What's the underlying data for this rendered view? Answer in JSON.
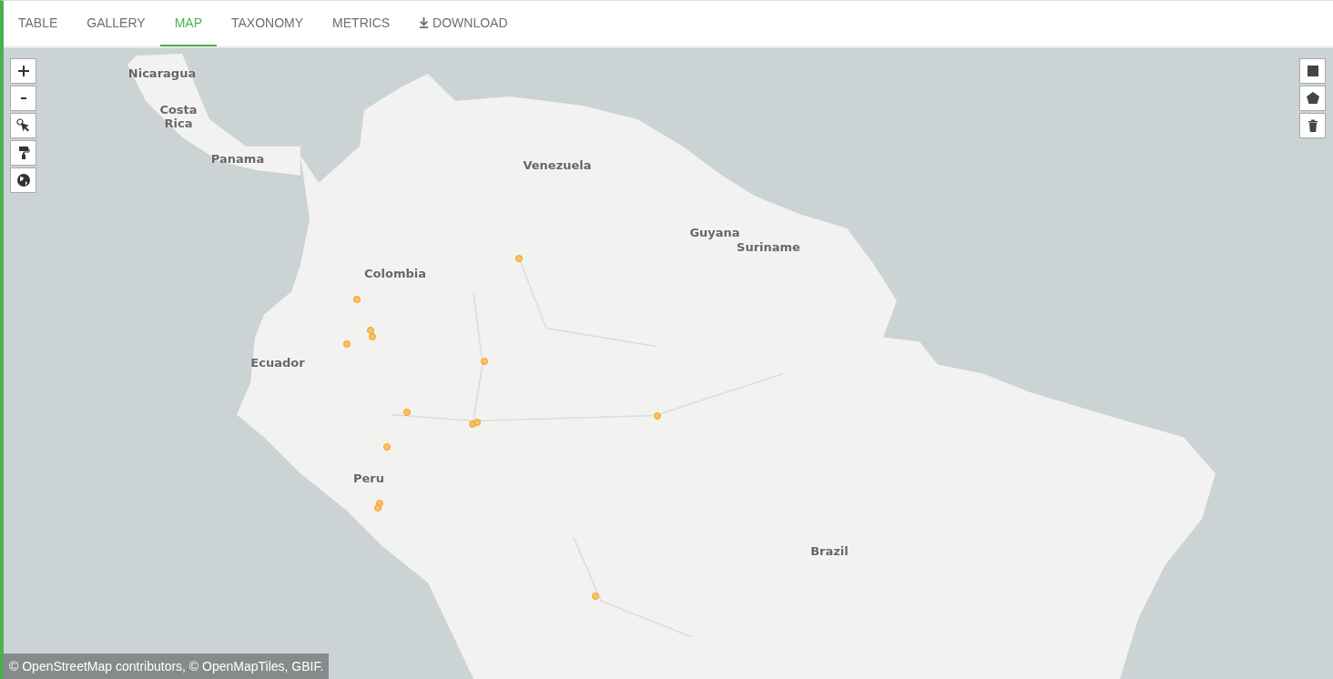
{
  "tabs": [
    {
      "label": "TABLE",
      "selected": false,
      "kind": "text"
    },
    {
      "label": "GALLERY",
      "selected": false,
      "kind": "text"
    },
    {
      "label": "MAP",
      "selected": true,
      "kind": "text"
    },
    {
      "label": "TAXONOMY",
      "selected": false,
      "kind": "text"
    },
    {
      "label": "METRICS",
      "selected": false,
      "kind": "text"
    },
    {
      "label": "DOWNLOAD",
      "selected": false,
      "kind": "download"
    }
  ],
  "map": {
    "labels": [
      "Nicaragua",
      "Costa\nRica",
      "Panama",
      "Venezuela",
      "Colombia",
      "Guyana",
      "Suriname",
      "Ecuador",
      "Peru",
      "Brazil"
    ],
    "attribution": "© OpenStreetMap contributors, © OpenMapTiles, GBIF."
  }
}
